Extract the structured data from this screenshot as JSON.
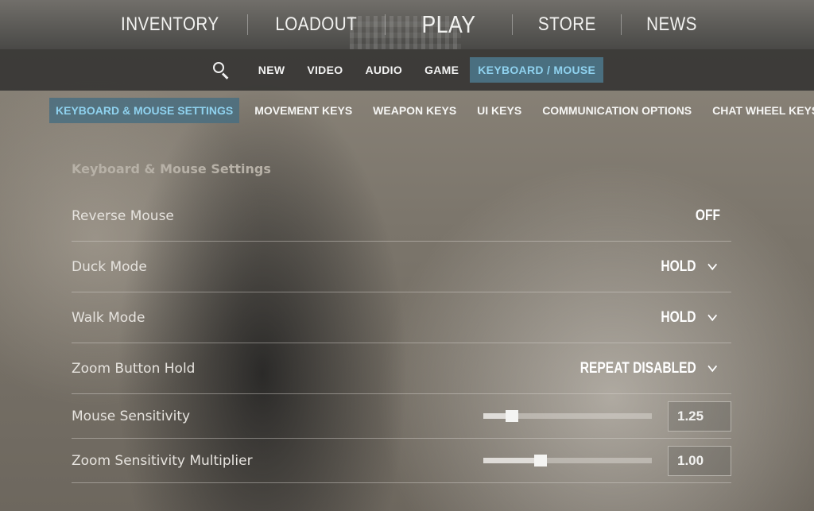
{
  "topnav": {
    "items": [
      {
        "label": "INVENTORY"
      },
      {
        "label": "LOADOUT"
      },
      {
        "label": "PLAY"
      },
      {
        "label": "STORE"
      },
      {
        "label": "NEWS"
      }
    ]
  },
  "settings_tabs": {
    "items": [
      "NEW",
      "VIDEO",
      "AUDIO",
      "GAME",
      "KEYBOARD / MOUSE"
    ],
    "active": "KEYBOARD / MOUSE"
  },
  "category_tabs": {
    "items": [
      "KEYBOARD & MOUSE SETTINGS",
      "MOVEMENT KEYS",
      "WEAPON KEYS",
      "UI KEYS",
      "COMMUNICATION OPTIONS",
      "CHAT WHEEL KEYS"
    ],
    "active": "KEYBOARD & MOUSE SETTINGS"
  },
  "section": {
    "title": "Keyboard & Mouse Settings",
    "rows": [
      {
        "label": "Reverse Mouse",
        "value": "OFF"
      },
      {
        "label": "Duck Mode",
        "value": "HOLD"
      },
      {
        "label": "Walk Mode",
        "value": "HOLD"
      },
      {
        "label": "Zoom Button Hold",
        "value": "REPEAT DISABLED"
      },
      {
        "label": "Mouse Sensitivity",
        "value": "1.25",
        "slider_fraction": 0.17
      },
      {
        "label": "Zoom Sensitivity Multiplier",
        "value": "1.00",
        "slider_fraction": 0.34
      }
    ]
  },
  "colors": {
    "accent_bg": "#4a6f80",
    "accent_text": "#8fd2ef"
  },
  "icons": {
    "search": "search-icon",
    "dropdown": "chevron-down-icon"
  }
}
